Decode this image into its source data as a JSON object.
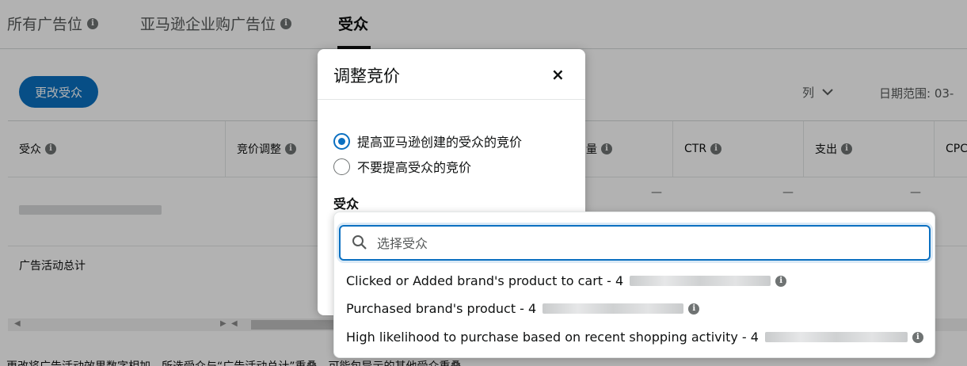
{
  "tabs": [
    {
      "label": "所有广告位",
      "info": true
    },
    {
      "label": "亚马逊企业购广告位",
      "info": true
    },
    {
      "label": "受众",
      "info": false
    }
  ],
  "toolbar": {
    "change_audience_label": "更改受众",
    "columns_label": "列",
    "date_range_label": "日期范围: 03-"
  },
  "table": {
    "headers": [
      "受众",
      "竞价调整",
      "量",
      "CTR",
      "支出",
      "CPC"
    ],
    "empty_value": "—",
    "total_label": "广告活动总计"
  },
  "footer_note": "更改将广告活动效果数字相加，所选受众与“广告活动总计”重叠，可能包导示的其他受众重叠",
  "modal": {
    "title": "调整竞价",
    "close_symbol": "×",
    "radio_options": [
      {
        "label": "提高亚马逊创建的受众的竞价",
        "checked": true
      },
      {
        "label": "不要提高受众的竞价",
        "checked": false
      }
    ],
    "audience_label": "受众"
  },
  "dropdown": {
    "search_placeholder": "选择受众",
    "options": [
      {
        "label": "Clicked or Added brand's product to cart - 4"
      },
      {
        "label": "Purchased brand's product - 4"
      },
      {
        "label": "High likelihood to purchase based on recent shopping activity - 4"
      }
    ]
  },
  "colors": {
    "accent": "#0b70c1",
    "text": "#0f1111",
    "muted": "#565959"
  }
}
